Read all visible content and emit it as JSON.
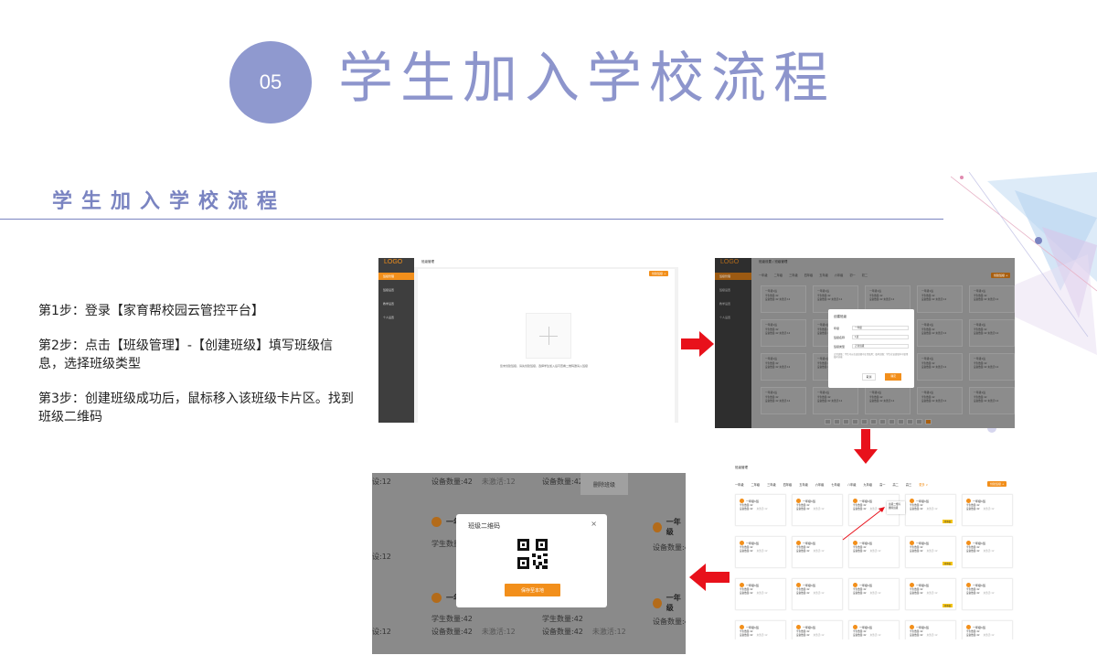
{
  "header": {
    "number": "05",
    "title": "学生加入学校流程",
    "subtitle": "学生加入学校流程"
  },
  "steps": [
    "第1步：登录【家育帮校园云管控平台】",
    "第2步：点击【班级管理】-【创建班级】填写班级信息，选择班级类型",
    "第3步：创建班级成功后，鼠标移入该班级卡片区。找到班级二维码"
  ],
  "colors": {
    "accent": "#8f99cf",
    "orange": "#f28f1b",
    "arrow_red": "#e8111b"
  },
  "shot1": {
    "logo": "LOGO",
    "page_title": "班级管理",
    "nav": [
      "班级管理",
      "班级设置",
      "教学设置",
      "个人设置"
    ],
    "create_button": "创建班级 +",
    "hint": "您未创建班级，请先创建班级，选择学生加入后可查看二维码邀请入班级"
  },
  "shot2": {
    "logo": "LOGO",
    "breadcrumb": "班级设置 / 班级管理",
    "nav": [
      "班级管理",
      "班级设置",
      "教学设置",
      "个人设置"
    ],
    "tabs": [
      "一年级",
      "二年级",
      "三年级",
      "四年级",
      "五年级",
      "六年级",
      "初一",
      "初二"
    ],
    "create_button": "创建班级 +",
    "card_name": "一年级1班",
    "card_line1": "学生数量:42",
    "card_line2": "设备数量:42 未激活:12",
    "dialog": {
      "title": "创建班级",
      "grade_label": "年级",
      "grade_value": "一年级",
      "name_label": "班级名称",
      "name_value": "1班",
      "type_label": "班级类型",
      "type_value": "正常班级",
      "note": "正常班级：学生可以在该班级中正常使用；临时班级：学生在该班级中可使用临时功能",
      "cancel": "取消",
      "ok": "确定"
    }
  },
  "shot3": {
    "breadcrumb": "班级管理",
    "tabs": [
      "一年级",
      "二年级",
      "三年级",
      "四年级",
      "五年级",
      "六年级",
      "七年级",
      "八年级",
      "九年级",
      "高一",
      "高二",
      "高三",
      "更多 ∨"
    ],
    "create_button": "创建班级 +",
    "card_name": "一年级1班",
    "card_line1": "学生数量:42",
    "card_line2": "设备数量:42",
    "card_inactive": "未激活:12",
    "tag": "待审核",
    "menu": [
      "班级二维码",
      "删除班级"
    ]
  },
  "shot4": {
    "bg_student": "学生数量:42",
    "bg_device": "设备数量:42",
    "bg_inactive": "未激活:12",
    "bg_inactive_partial": "设:12",
    "bg_name_partial": "一年",
    "bg_name_partial2": "一年级",
    "menu_item": "删除班级",
    "dialog_title": "班级二维码",
    "close": "×",
    "save_button": "保存至本地"
  }
}
